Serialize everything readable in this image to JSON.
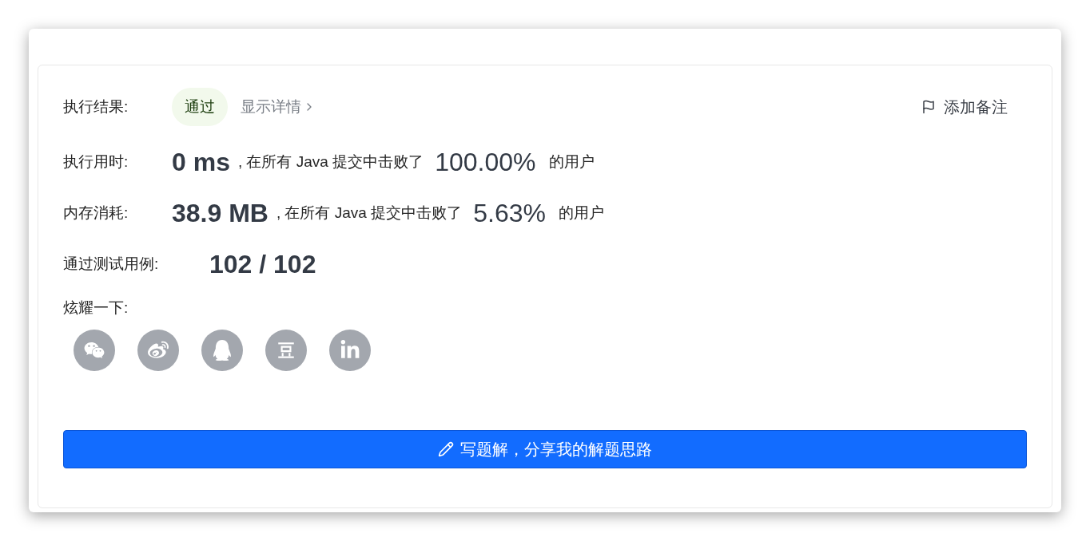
{
  "result": {
    "label": "执行结果:",
    "badge": "通过",
    "details_link": "显示详情",
    "add_note": "添加备注"
  },
  "stats": [
    {
      "label": "执行用时:",
      "value": "0 ms",
      "middle": ", 在所有 Java 提交中击败了",
      "percent": "100.00%",
      "suffix": "的用户"
    },
    {
      "label": "内存消耗:",
      "value": "38.9 MB",
      "middle": ", 在所有 Java 提交中击败了",
      "percent": "5.63%",
      "suffix": "的用户"
    }
  ],
  "tests": {
    "label": "通过测试用例:",
    "value": "102 / 102"
  },
  "share": {
    "label": "炫耀一下:",
    "items": [
      {
        "kind": "wechat"
      },
      {
        "kind": "weibo"
      },
      {
        "kind": "qq"
      },
      {
        "kind": "douban"
      },
      {
        "kind": "linkedin"
      }
    ]
  },
  "write_button": "写题解，分享我的解题思路"
}
